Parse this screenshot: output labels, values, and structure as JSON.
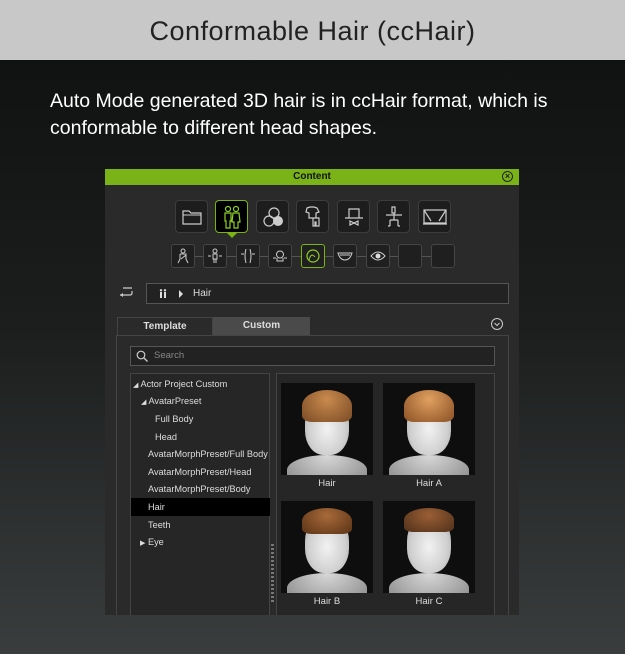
{
  "header": {
    "title": "Conformable Hair (ccHair)"
  },
  "intro": {
    "text": "Auto Mode generated 3D hair is in ccHair format, which is conformable to different head shapes."
  },
  "window": {
    "title": "Content",
    "accent": "#7ab317"
  },
  "categories": [
    "folder-icon",
    "actor-icon",
    "material-icon",
    "clothing-icon",
    "accessory-icon",
    "motion-icon",
    "stage-icon"
  ],
  "subcategories": [
    "body-icon",
    "morph-body-icon",
    "morph-waist-icon",
    "morph-head-icon",
    "hair-icon",
    "teeth-icon",
    "eye-icon",
    "empty-icon",
    "empty-icon"
  ],
  "breadcrumb": {
    "item": "Hair"
  },
  "tabs": {
    "template": "Template",
    "custom": "Custom"
  },
  "search": {
    "placeholder": "Search"
  },
  "tree": [
    {
      "label": "Actor Project Custom",
      "expanded": true
    },
    {
      "label": "AvatarPreset",
      "expanded": true
    },
    {
      "label": "Full Body"
    },
    {
      "label": "Head"
    },
    {
      "label": "AvatarMorphPreset/Full Body"
    },
    {
      "label": "AvatarMorphPreset/Head"
    },
    {
      "label": "AvatarMorphPreset/Body"
    },
    {
      "label": "Hair",
      "selected": true
    },
    {
      "label": "Teeth"
    },
    {
      "label": "Eye",
      "expanded": false
    }
  ],
  "items": [
    {
      "label": "Hair"
    },
    {
      "label": "Hair A"
    },
    {
      "label": "Hair B"
    },
    {
      "label": "Hair C"
    }
  ]
}
